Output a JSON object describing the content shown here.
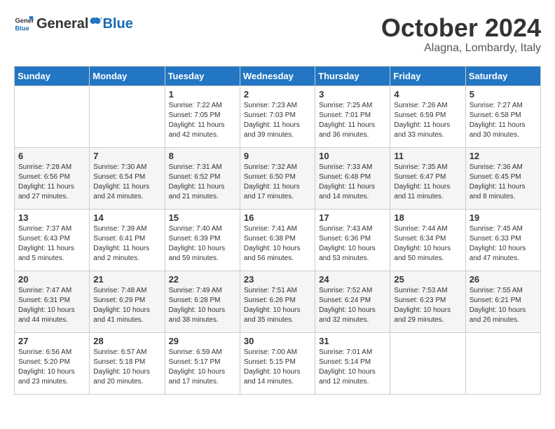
{
  "header": {
    "logo_general": "General",
    "logo_blue": "Blue",
    "month": "October 2024",
    "location": "Alagna, Lombardy, Italy"
  },
  "weekdays": [
    "Sunday",
    "Monday",
    "Tuesday",
    "Wednesday",
    "Thursday",
    "Friday",
    "Saturday"
  ],
  "weeks": [
    [
      {
        "day": "",
        "info": ""
      },
      {
        "day": "",
        "info": ""
      },
      {
        "day": "1",
        "info": "Sunrise: 7:22 AM\nSunset: 7:05 PM\nDaylight: 11 hours and 42 minutes."
      },
      {
        "day": "2",
        "info": "Sunrise: 7:23 AM\nSunset: 7:03 PM\nDaylight: 11 hours and 39 minutes."
      },
      {
        "day": "3",
        "info": "Sunrise: 7:25 AM\nSunset: 7:01 PM\nDaylight: 11 hours and 36 minutes."
      },
      {
        "day": "4",
        "info": "Sunrise: 7:26 AM\nSunset: 6:59 PM\nDaylight: 11 hours and 33 minutes."
      },
      {
        "day": "5",
        "info": "Sunrise: 7:27 AM\nSunset: 6:58 PM\nDaylight: 11 hours and 30 minutes."
      }
    ],
    [
      {
        "day": "6",
        "info": "Sunrise: 7:28 AM\nSunset: 6:56 PM\nDaylight: 11 hours and 27 minutes."
      },
      {
        "day": "7",
        "info": "Sunrise: 7:30 AM\nSunset: 6:54 PM\nDaylight: 11 hours and 24 minutes."
      },
      {
        "day": "8",
        "info": "Sunrise: 7:31 AM\nSunset: 6:52 PM\nDaylight: 11 hours and 21 minutes."
      },
      {
        "day": "9",
        "info": "Sunrise: 7:32 AM\nSunset: 6:50 PM\nDaylight: 11 hours and 17 minutes."
      },
      {
        "day": "10",
        "info": "Sunrise: 7:33 AM\nSunset: 6:48 PM\nDaylight: 11 hours and 14 minutes."
      },
      {
        "day": "11",
        "info": "Sunrise: 7:35 AM\nSunset: 6:47 PM\nDaylight: 11 hours and 11 minutes."
      },
      {
        "day": "12",
        "info": "Sunrise: 7:36 AM\nSunset: 6:45 PM\nDaylight: 11 hours and 8 minutes."
      }
    ],
    [
      {
        "day": "13",
        "info": "Sunrise: 7:37 AM\nSunset: 6:43 PM\nDaylight: 11 hours and 5 minutes."
      },
      {
        "day": "14",
        "info": "Sunrise: 7:39 AM\nSunset: 6:41 PM\nDaylight: 11 hours and 2 minutes."
      },
      {
        "day": "15",
        "info": "Sunrise: 7:40 AM\nSunset: 6:39 PM\nDaylight: 10 hours and 59 minutes."
      },
      {
        "day": "16",
        "info": "Sunrise: 7:41 AM\nSunset: 6:38 PM\nDaylight: 10 hours and 56 minutes."
      },
      {
        "day": "17",
        "info": "Sunrise: 7:43 AM\nSunset: 6:36 PM\nDaylight: 10 hours and 53 minutes."
      },
      {
        "day": "18",
        "info": "Sunrise: 7:44 AM\nSunset: 6:34 PM\nDaylight: 10 hours and 50 minutes."
      },
      {
        "day": "19",
        "info": "Sunrise: 7:45 AM\nSunset: 6:33 PM\nDaylight: 10 hours and 47 minutes."
      }
    ],
    [
      {
        "day": "20",
        "info": "Sunrise: 7:47 AM\nSunset: 6:31 PM\nDaylight: 10 hours and 44 minutes."
      },
      {
        "day": "21",
        "info": "Sunrise: 7:48 AM\nSunset: 6:29 PM\nDaylight: 10 hours and 41 minutes."
      },
      {
        "day": "22",
        "info": "Sunrise: 7:49 AM\nSunset: 6:28 PM\nDaylight: 10 hours and 38 minutes."
      },
      {
        "day": "23",
        "info": "Sunrise: 7:51 AM\nSunset: 6:26 PM\nDaylight: 10 hours and 35 minutes."
      },
      {
        "day": "24",
        "info": "Sunrise: 7:52 AM\nSunset: 6:24 PM\nDaylight: 10 hours and 32 minutes."
      },
      {
        "day": "25",
        "info": "Sunrise: 7:53 AM\nSunset: 6:23 PM\nDaylight: 10 hours and 29 minutes."
      },
      {
        "day": "26",
        "info": "Sunrise: 7:55 AM\nSunset: 6:21 PM\nDaylight: 10 hours and 26 minutes."
      }
    ],
    [
      {
        "day": "27",
        "info": "Sunrise: 6:56 AM\nSunset: 5:20 PM\nDaylight: 10 hours and 23 minutes."
      },
      {
        "day": "28",
        "info": "Sunrise: 6:57 AM\nSunset: 5:18 PM\nDaylight: 10 hours and 20 minutes."
      },
      {
        "day": "29",
        "info": "Sunrise: 6:59 AM\nSunset: 5:17 PM\nDaylight: 10 hours and 17 minutes."
      },
      {
        "day": "30",
        "info": "Sunrise: 7:00 AM\nSunset: 5:15 PM\nDaylight: 10 hours and 14 minutes."
      },
      {
        "day": "31",
        "info": "Sunrise: 7:01 AM\nSunset: 5:14 PM\nDaylight: 10 hours and 12 minutes."
      },
      {
        "day": "",
        "info": ""
      },
      {
        "day": "",
        "info": ""
      }
    ]
  ]
}
